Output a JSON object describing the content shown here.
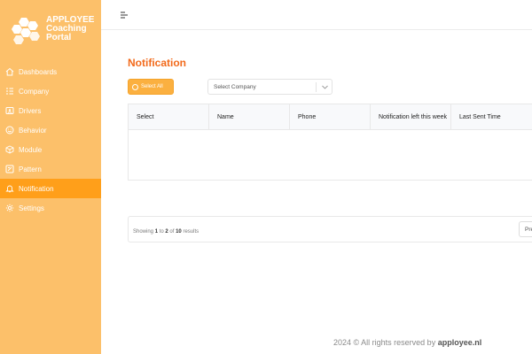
{
  "brand": {
    "line1": "APPLOYEE",
    "line2": "Coaching",
    "line3": "Portal"
  },
  "sidebar": {
    "items": [
      {
        "label": "Dashboards",
        "icon": "home-icon",
        "active": false
      },
      {
        "label": "Company",
        "icon": "company-list-icon",
        "active": false
      },
      {
        "label": "Drivers",
        "icon": "id-card-icon",
        "active": false
      },
      {
        "label": "Behavior",
        "icon": "smile-icon",
        "active": false
      },
      {
        "label": "Module",
        "icon": "cube-icon",
        "active": false
      },
      {
        "label": "Pattern",
        "icon": "pattern-icon",
        "active": false
      },
      {
        "label": "Notification",
        "icon": "bell-icon",
        "active": true
      },
      {
        "label": "Settings",
        "icon": "gear-icon",
        "active": false
      }
    ]
  },
  "page": {
    "title": "Notification",
    "select_all_label": "Select All",
    "company_select_placeholder": "Select Company"
  },
  "table": {
    "columns": [
      "Select",
      "Name",
      "Phone",
      "Notification left this week",
      "Last Sent Time"
    ]
  },
  "pagination": {
    "prefix": "Showing",
    "from": "1",
    "to_word": "to",
    "to": "2",
    "of_word": "of",
    "total": "10",
    "suffix": "results",
    "prev_label": "Pre"
  },
  "footer": {
    "text": "2024 © All rights reserved by",
    "brand": "apployee.nl"
  },
  "colors": {
    "sidebar_bg": "#fcc06a",
    "active_item_bg": "#ff9f1a",
    "title_orange": "#f26a1b",
    "button_orange": "#fbb040"
  }
}
